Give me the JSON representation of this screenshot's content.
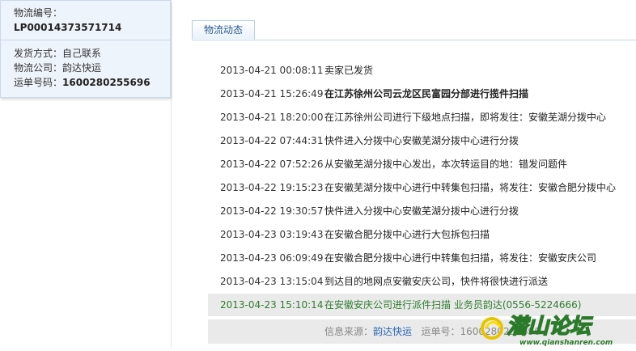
{
  "sidebar": {
    "logistics_no_label": "物流编号：",
    "logistics_no": "LP00014373571714",
    "shipping_method": "发货方式：自己联系",
    "company_label": "物流公司：",
    "company": "韵达快运",
    "waybill_label": "运单号码：",
    "waybill_no": "1600280255696"
  },
  "tab": {
    "label": "物流动态"
  },
  "events": [
    {
      "time": "2013-04-21 00:08:11",
      "desc": "卖家已发货"
    },
    {
      "time": "2013-04-21 15:26:49",
      "desc": "在江苏徐州公司云龙区民富园分部进行揽件扫描"
    },
    {
      "time": "2013-04-21 18:20:00",
      "desc": "在江苏徐州公司进行下级地点扫描，即将发往：安徽芜湖分拨中心"
    },
    {
      "time": "2013-04-22 07:44:31",
      "desc": "快件进入分拨中心安徽芜湖分拨中心进行分拨"
    },
    {
      "time": "2013-04-22 07:52:26",
      "desc": "从安徽芜湖分拨中心发出，本次转运目的地：错发问题件"
    },
    {
      "time": "2013-04-22 19:15:23",
      "desc": "在安徽芜湖分拨中心进行中转集包扫描，将发往：安徽合肥分拨中心"
    },
    {
      "time": "2013-04-22 19:30:57",
      "desc": "快件进入分拨中心安徽芜湖分拨中心进行分拨"
    },
    {
      "time": "2013-04-23 03:19:43",
      "desc": "在安徽合肥分拨中心进行大包拆包扫描"
    },
    {
      "time": "2013-04-23 06:09:49",
      "desc": "在安徽合肥分拨中心进行中转集包扫描，将发往：安徽安庆公司"
    },
    {
      "time": "2013-04-23 13:15:04",
      "desc": "到达目的地网点安徽安庆公司，快件将很快进行派送"
    },
    {
      "time": "2013-04-23 15:10:14",
      "desc": "在安徽安庆公司进行派件扫描 业务员韵达(0556-5224666)"
    }
  ],
  "source": {
    "label": "信息来源：",
    "company": "韵达快运",
    "waybill_label": "运单号：",
    "waybill_no": "1600280255696"
  },
  "watermark": {
    "title": "潜山论坛",
    "url": "www.qianshanren.com"
  }
}
